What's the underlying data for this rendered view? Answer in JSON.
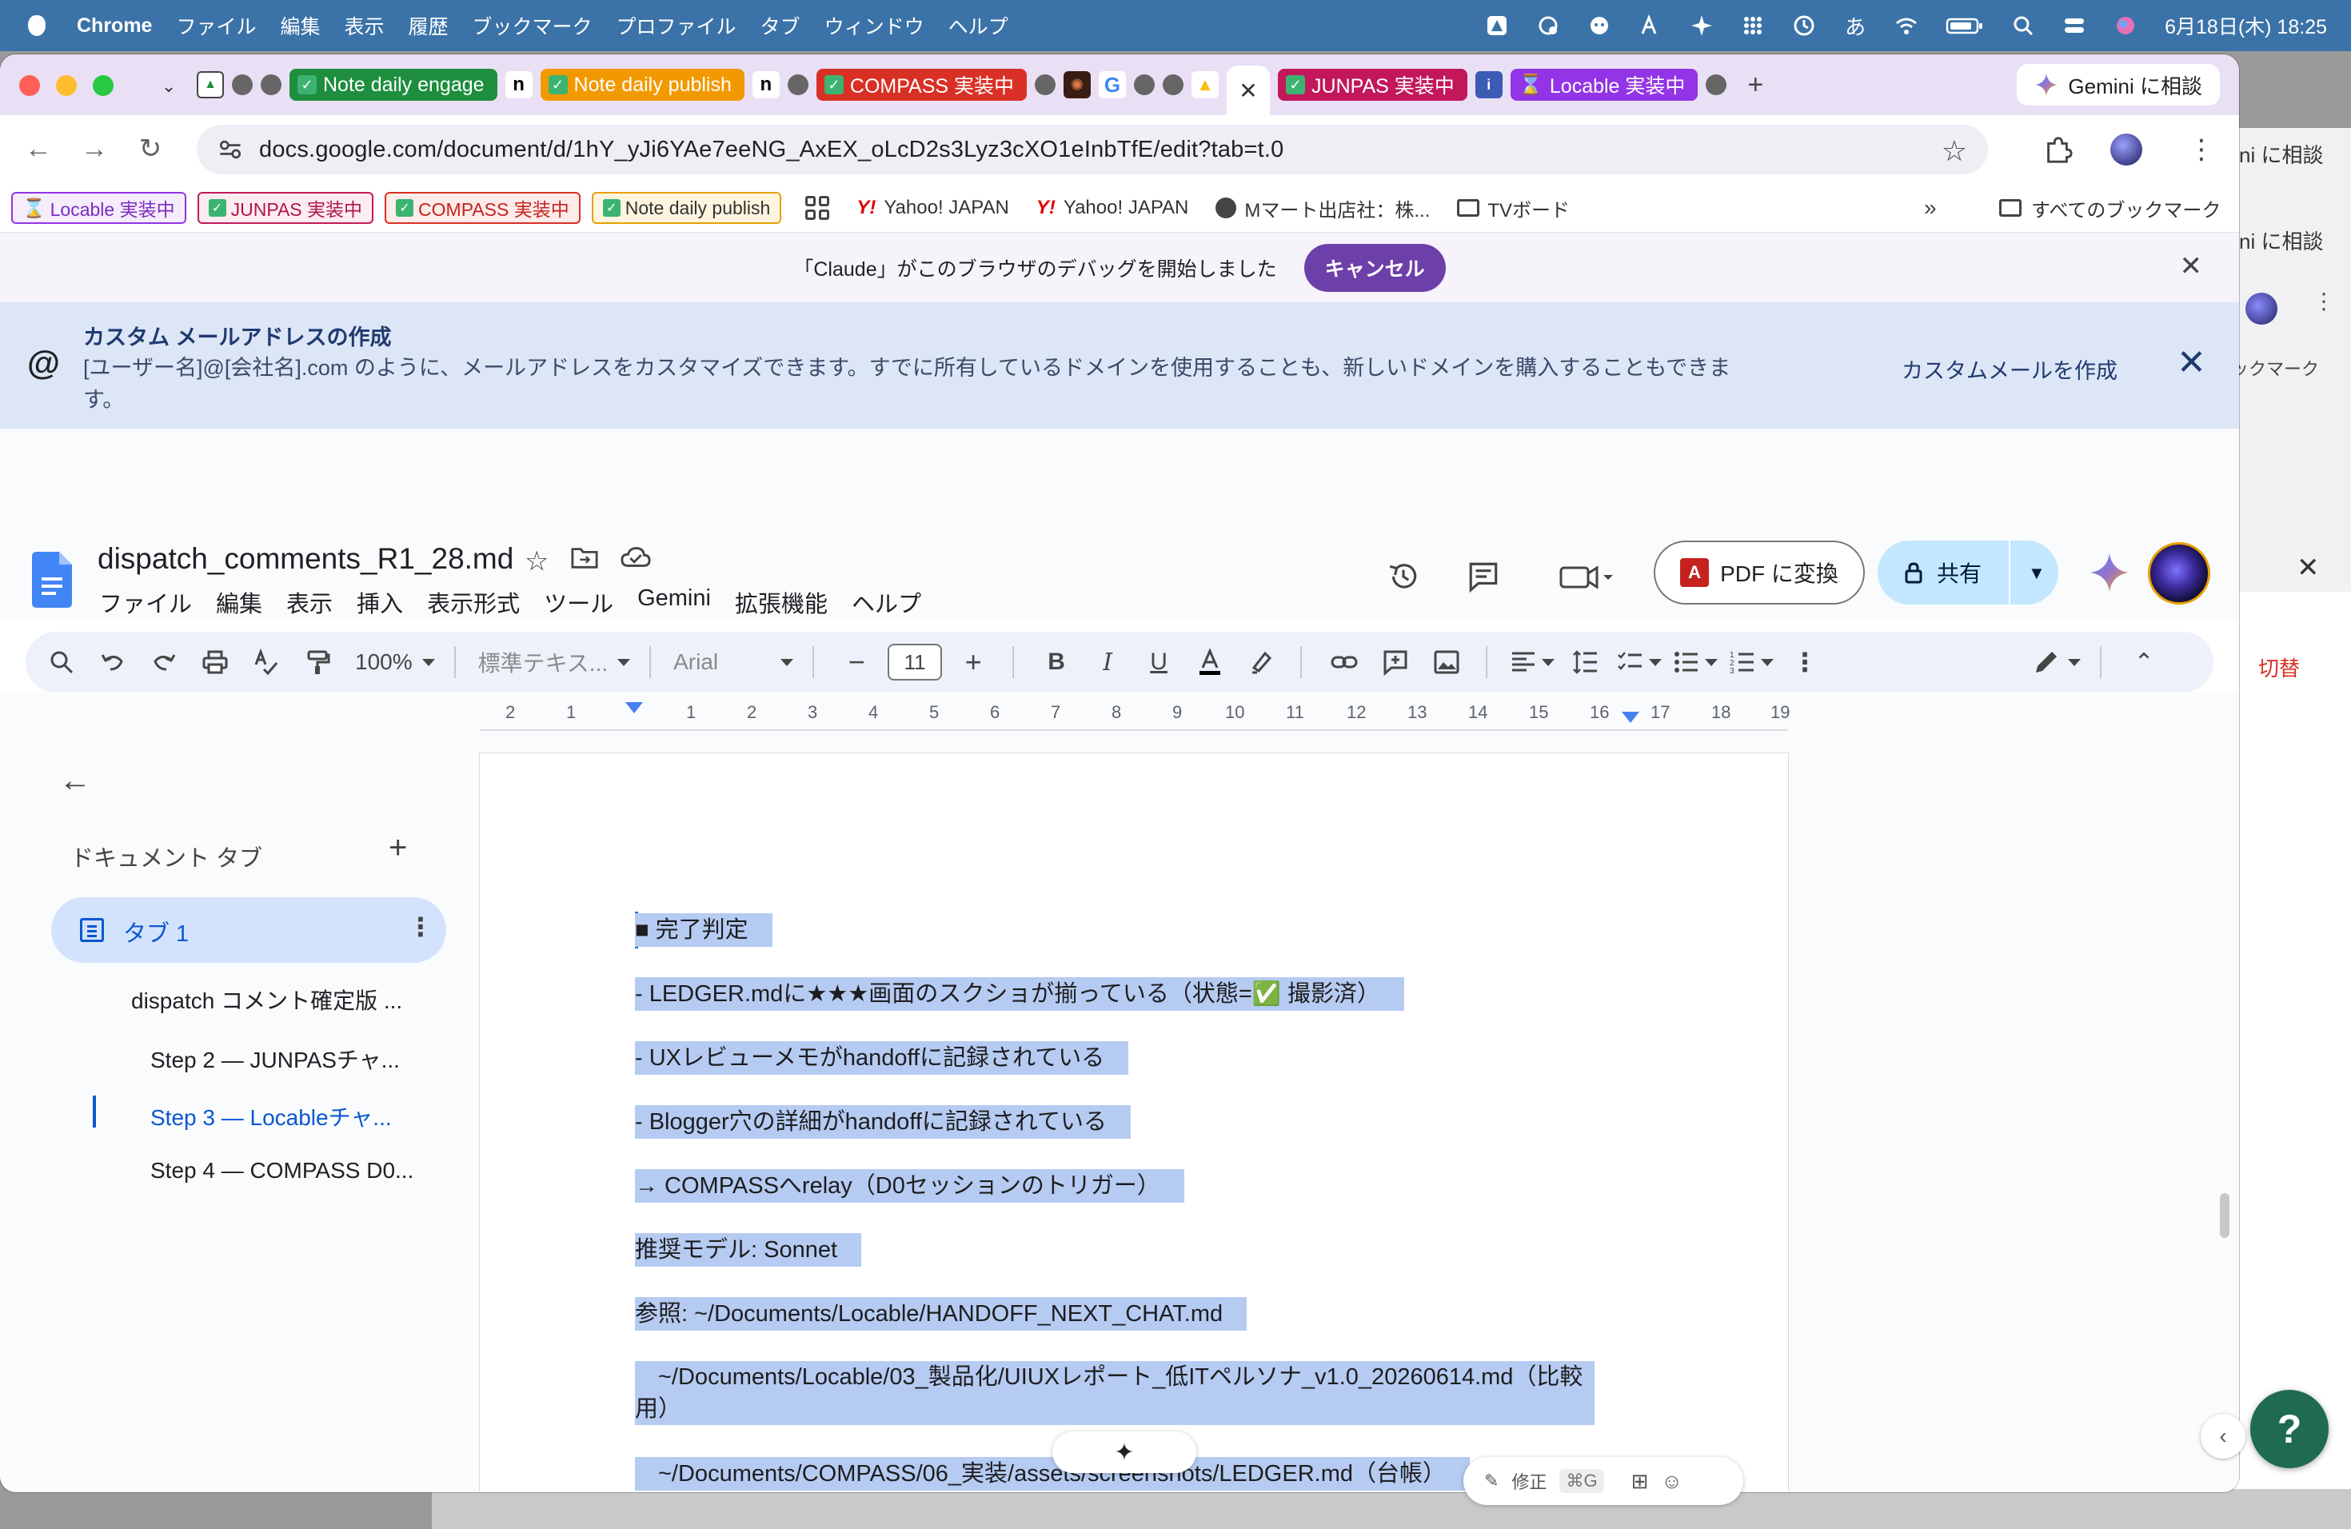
{
  "menubar": {
    "app": "Chrome",
    "items": [
      "ファイル",
      "編集",
      "表示",
      "履歴",
      "ブックマーク",
      "プロファイル",
      "タブ",
      "ウィンドウ",
      "ヘルプ"
    ],
    "ime": "あ",
    "datetime": "6月18日(木) 18:25"
  },
  "tabs": {
    "chips": [
      {
        "label": "Note daily engage",
        "color": "green"
      },
      {
        "label": "Note daily publish",
        "color": "orange"
      },
      {
        "label": "COMPASS 実装中",
        "color": "red"
      },
      {
        "label": "JUNPAS 実装中",
        "color": "pink"
      },
      {
        "label": "Locable 実装中",
        "color": "purple"
      }
    ],
    "active_close": "✕",
    "gemini_button": "Gemini に相談"
  },
  "toolbar": {
    "url": "docs.google.com/document/d/1hY_yJi6YAe7eeNG_AxEX_oLcD2s3Lyz3cXO1eInbTfE/edit?tab=t.0"
  },
  "bookmarks": {
    "chips": [
      {
        "label": "Locable 実装中",
        "style": "purple"
      },
      {
        "label": "JUNPAS 実装中",
        "style": "pink"
      },
      {
        "label": "COMPASS 実装中",
        "style": "red"
      },
      {
        "label": "Note daily publish",
        "style": "orange"
      }
    ],
    "yahoo1": "Yahoo! JAPAN",
    "yahoo2": "Yahoo! JAPAN",
    "mmart": "Mマート出店社：株...",
    "tvboard": "TVボード",
    "all": "すべてのブックマーク"
  },
  "debugbar": {
    "message": "「Claude」がこのブラウザのデバッグを開始しました",
    "cancel": "キャンセル"
  },
  "banner": {
    "title": "カスタム メールアドレスの作成",
    "text": "[ユーザー名]@[会社名].com のように、メールアドレスをカスタマイズできます。すでに所有しているドメインを使用することも、新しいドメインを購入することもできます。",
    "link": "カスタムメールを作成"
  },
  "doc": {
    "title": "dispatch_comments_R1_28.md",
    "menu": [
      "ファイル",
      "編集",
      "表示",
      "挿入",
      "表示形式",
      "ツール",
      "Gemini",
      "拡張機能",
      "ヘルプ"
    ],
    "pdf_button": "PDF に変換",
    "share_button": "共有"
  },
  "format": {
    "zoom": "100%",
    "style": "標準テキス...",
    "font": "Arial",
    "size": "11"
  },
  "ruler": {
    "ticks": [
      "2",
      "1",
      "1",
      "2",
      "3",
      "4",
      "5",
      "6",
      "7",
      "8",
      "9",
      "10",
      "11",
      "12",
      "13",
      "14",
      "15",
      "16",
      "17",
      "18",
      "19"
    ]
  },
  "outline": {
    "heading": "ドキュメント タブ",
    "tab_label": "タブ 1",
    "items": [
      "dispatch コメント確定版 ...",
      "Step 2 — JUNPASチャ...",
      "Step 3 — Locableチャ...",
      "Step 4 — COMPASS D0..."
    ]
  },
  "content": {
    "lines": [
      "■ 完了判定",
      "- LEDGER.mdに★★★画面のスクショが揃っている（状態=✅ 撮影済）",
      "- UXレビューメモがhandoffに記録されている",
      "- Blogger穴の詳細がhandoffに記録されている",
      "→ COMPASSへrelay（D0セッションのトリガー）",
      "推奨モデル: Sonnet",
      "参照: ~/Documents/Locable/HANDOFF_NEXT_CHAT.md",
      "　~/Documents/Locable/03_製品化/UIUXレポート_低ITペルソナ_v1.0_20260614.md（比較用）",
      "　~/Documents/COMPASS/06_実装/assets/screenshots/LEDGER.md（台帳）"
    ]
  },
  "floating": {
    "edit_label": "修正",
    "edit_shortcut": "⌘G",
    "help": "?"
  },
  "bgwindow": {
    "t1": "ni に相談",
    "t2": "ni に相談",
    "t3": "ックマーク",
    "switch": "切替"
  }
}
